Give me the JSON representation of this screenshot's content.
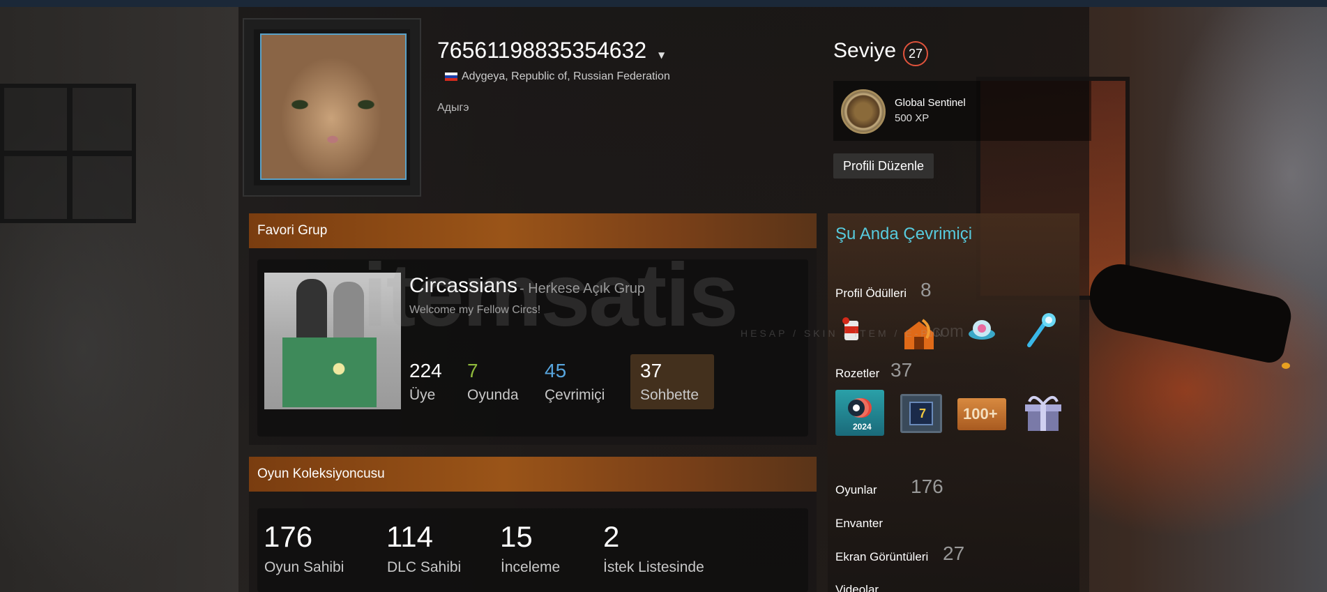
{
  "profile": {
    "username": "76561198835354632",
    "location": "Adygeya, Republic of, Russian Federation",
    "real_name": "Адыгэ",
    "level_label": "Seviye",
    "level": "27",
    "featured_badge": {
      "name": "Global Sentinel",
      "xp": "500 XP"
    },
    "edit_button": "Profili Düzenle"
  },
  "favorite_group": {
    "section_title": "Favori Grup",
    "name": "Circassians",
    "separator": "- Herkese Açık Grup",
    "description": "Welcome my Fellow Circs!",
    "stats": [
      {
        "value": "224",
        "label": "Üye",
        "color": "#ffffff"
      },
      {
        "value": "7",
        "label": "Oyunda",
        "color": "#90ba3c"
      },
      {
        "value": "45",
        "label": "Çevrimiçi",
        "color": "#57a5de"
      },
      {
        "value": "37",
        "label": "Sohbette",
        "color": "#ffffff"
      }
    ]
  },
  "collector": {
    "section_title": "Oyun Koleksiyoncusu",
    "stats": [
      {
        "value": "176",
        "label": "Oyun Sahibi"
      },
      {
        "value": "114",
        "label": "DLC Sahibi"
      },
      {
        "value": "15",
        "label": "İnceleme"
      },
      {
        "value": "2",
        "label": "İstek Listesinde"
      }
    ]
  },
  "sidebar": {
    "status": "Şu Anda Çevrimiçi",
    "awards_label": "Profil Ödülleri",
    "awards_count": "8",
    "badges_label": "Rozetler",
    "badges_count": "37",
    "badges": [
      {
        "icon": "steam-2024-badge-icon",
        "text": "2024"
      },
      {
        "icon": "years-of-service-badge-icon",
        "text": "7"
      },
      {
        "icon": "100-plus-badge-icon",
        "text": "100+"
      },
      {
        "icon": "gift-box-badge-icon",
        "text": ""
      }
    ],
    "games_label": "Oyunlar",
    "games_count": "176",
    "inventory_label": "Envanter",
    "screenshots_label": "Ekran Görüntüleri",
    "screenshots_count": "27",
    "videos_label": "Videolar"
  },
  "watermark": {
    "brand": "itemsatis",
    "tagline": "HESAP / SKIN / İTEM / E-PIN",
    "suffix": ".com"
  },
  "colors": {
    "accent_online": "#57cbde",
    "level_ring": "#e0533c",
    "section_header": "#9a5418"
  }
}
